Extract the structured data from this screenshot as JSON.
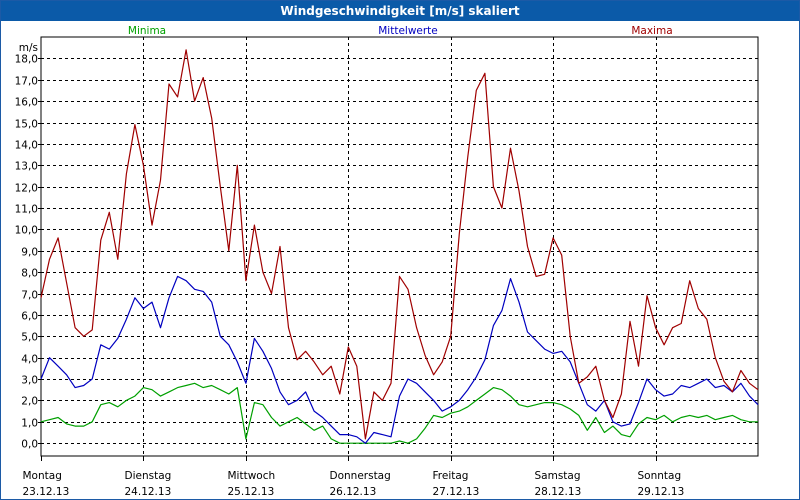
{
  "title": "Windgeschwindigkeit [m/s] skaliert",
  "colors": {
    "minima": "#00a000",
    "mittel": "#0000c0",
    "maxima": "#a00000",
    "title_bg": "#0b5aa8"
  },
  "chart_data": {
    "type": "line",
    "title": "Windgeschwindigkeit [m/s] skaliert",
    "ylabel": "m/s",
    "ylim": [
      -0.6,
      19.0
    ],
    "yticks": [
      "0,0",
      "1,0",
      "2,0",
      "3,0",
      "4,0",
      "5,0",
      "6,0",
      "7,0",
      "8,0",
      "9,0",
      "10,0",
      "11,0",
      "12,0",
      "13,0",
      "14,0",
      "15,0",
      "16,0",
      "17,0",
      "18,0"
    ],
    "x_range_hours": [
      0,
      168
    ],
    "x_tick_hours": [
      0,
      24,
      48,
      72,
      96,
      120,
      144
    ],
    "x_labels": [
      {
        "day": "Montag",
        "date": "23.12.13"
      },
      {
        "day": "Dienstag",
        "date": "24.12.13"
      },
      {
        "day": "Mittwoch",
        "date": "25.12.13"
      },
      {
        "day": "Donnerstag",
        "date": "26.12.13"
      },
      {
        "day": "Freitag",
        "date": "27.12.13"
      },
      {
        "day": "Samstag",
        "date": "28.12.13"
      },
      {
        "day": "Sonntag",
        "date": "29.12.13"
      }
    ],
    "grid": true,
    "legend": "top",
    "series": [
      {
        "name": "Minima",
        "x": [
          0,
          2,
          4,
          6,
          8,
          10,
          12,
          14,
          16,
          18,
          20,
          22,
          24,
          26,
          28,
          30,
          32,
          34,
          36,
          38,
          40,
          42,
          44,
          46,
          48,
          50,
          52,
          54,
          56,
          58,
          60,
          62,
          64,
          66,
          68,
          70,
          72,
          74,
          76,
          78,
          80,
          82,
          84,
          86,
          88,
          90,
          92,
          94,
          96,
          98,
          100,
          102,
          104,
          106,
          108,
          110,
          112,
          114,
          116,
          118,
          120,
          122,
          124,
          126,
          128,
          130,
          132,
          134,
          136,
          138,
          140,
          142,
          144,
          146,
          148,
          150,
          152,
          154,
          156,
          158,
          160,
          162,
          164,
          166,
          168
        ],
        "values": [
          1.0,
          1.1,
          1.2,
          0.9,
          0.8,
          0.8,
          1.0,
          1.8,
          1.9,
          1.7,
          2.0,
          2.2,
          2.6,
          2.5,
          2.2,
          2.4,
          2.6,
          2.7,
          2.8,
          2.6,
          2.7,
          2.5,
          2.3,
          2.6,
          0.2,
          1.9,
          1.8,
          1.2,
          0.8,
          1.0,
          1.2,
          0.9,
          0.6,
          0.8,
          0.2,
          0.0,
          0.0,
          0.0,
          0.0,
          0.0,
          0.0,
          0.0,
          0.1,
          0.0,
          0.2,
          0.7,
          1.3,
          1.2,
          1.4,
          1.5,
          1.7,
          2.0,
          2.3,
          2.6,
          2.5,
          2.2,
          1.8,
          1.7,
          1.8,
          1.9,
          1.9,
          1.8,
          1.6,
          1.3,
          0.6,
          1.2,
          0.5,
          0.8,
          0.4,
          0.3,
          0.9,
          1.2,
          1.1,
          1.3,
          1.0,
          1.2,
          1.3,
          1.2,
          1.3,
          1.1,
          1.2,
          1.3,
          1.1,
          1.0,
          1.0
        ]
      },
      {
        "name": "Mittelwerte",
        "x": [
          0,
          2,
          4,
          6,
          8,
          10,
          12,
          14,
          16,
          18,
          20,
          22,
          24,
          26,
          28,
          30,
          32,
          34,
          36,
          38,
          40,
          42,
          44,
          46,
          48,
          50,
          52,
          54,
          56,
          58,
          60,
          62,
          64,
          66,
          68,
          70,
          72,
          74,
          76,
          78,
          80,
          82,
          84,
          86,
          88,
          90,
          92,
          94,
          96,
          98,
          100,
          102,
          104,
          106,
          108,
          110,
          112,
          114,
          116,
          118,
          120,
          122,
          124,
          126,
          128,
          130,
          132,
          134,
          136,
          138,
          140,
          142,
          144,
          146,
          148,
          150,
          152,
          154,
          156,
          158,
          160,
          162,
          164,
          166,
          168
        ],
        "values": [
          3.0,
          4.0,
          3.6,
          3.2,
          2.6,
          2.7,
          3.0,
          4.6,
          4.4,
          4.9,
          5.8,
          6.8,
          6.3,
          6.6,
          5.4,
          6.8,
          7.8,
          7.6,
          7.2,
          7.1,
          6.6,
          5.0,
          4.6,
          3.8,
          2.8,
          4.9,
          4.3,
          3.5,
          2.4,
          1.8,
          2.0,
          2.4,
          1.5,
          1.2,
          0.8,
          0.4,
          0.4,
          0.3,
          0.0,
          0.5,
          0.4,
          0.3,
          2.2,
          3.0,
          2.8,
          2.4,
          2.0,
          1.5,
          1.7,
          2.0,
          2.5,
          3.1,
          3.9,
          5.5,
          6.2,
          7.7,
          6.6,
          5.2,
          4.8,
          4.4,
          4.2,
          4.3,
          3.8,
          2.8,
          1.8,
          1.5,
          2.0,
          1.0,
          0.8,
          0.9,
          1.9,
          3.0,
          2.5,
          2.2,
          2.3,
          2.7,
          2.6,
          2.8,
          3.0,
          2.6,
          2.7,
          2.4,
          2.8,
          2.2,
          1.8
        ]
      },
      {
        "name": "Maxima",
        "x": [
          0,
          2,
          4,
          6,
          8,
          10,
          12,
          14,
          16,
          18,
          20,
          22,
          24,
          26,
          28,
          30,
          32,
          34,
          36,
          38,
          40,
          42,
          44,
          46,
          48,
          50,
          52,
          54,
          56,
          58,
          60,
          62,
          64,
          66,
          68,
          70,
          72,
          74,
          76,
          78,
          80,
          82,
          84,
          86,
          88,
          90,
          92,
          94,
          96,
          98,
          100,
          102,
          104,
          106,
          108,
          110,
          112,
          114,
          116,
          118,
          120,
          122,
          124,
          126,
          128,
          130,
          132,
          134,
          136,
          138,
          140,
          142,
          144,
          146,
          148,
          150,
          152,
          154,
          156,
          158,
          160,
          162,
          164,
          166,
          168
        ],
        "values": [
          6.8,
          8.6,
          9.6,
          7.5,
          5.4,
          5.0,
          5.3,
          9.5,
          10.8,
          8.6,
          12.6,
          14.9,
          13.0,
          10.2,
          12.3,
          16.8,
          16.2,
          18.4,
          16.0,
          17.1,
          15.2,
          12.0,
          9.0,
          13.0,
          7.6,
          10.2,
          8.0,
          7.0,
          9.2,
          5.4,
          3.9,
          4.3,
          3.8,
          3.2,
          3.6,
          2.3,
          4.5,
          3.6,
          0.2,
          2.4,
          2.0,
          2.8,
          7.8,
          7.2,
          5.4,
          4.1,
          3.2,
          3.8,
          5.0,
          9.8,
          13.4,
          16.5,
          17.3,
          12.0,
          11.0,
          13.8,
          11.8,
          9.2,
          7.8,
          7.9,
          9.6,
          8.8,
          5.0,
          2.8,
          3.1,
          3.6,
          2.0,
          1.2,
          2.3,
          5.7,
          3.6,
          6.9,
          5.4,
          4.6,
          5.4,
          5.6,
          7.6,
          6.3,
          5.8,
          4.0,
          2.9,
          2.4,
          3.4,
          2.8,
          2.5
        ]
      }
    ]
  }
}
